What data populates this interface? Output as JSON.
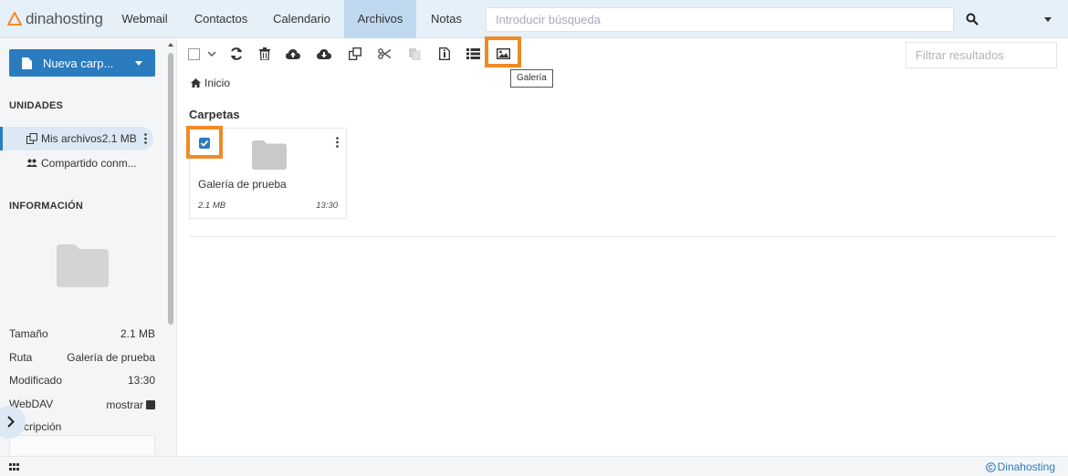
{
  "brand": {
    "name": "dinahosting",
    "accent": "#f08a24",
    "primary": "#2b7bbf"
  },
  "nav": {
    "items": [
      {
        "label": "Webmail"
      },
      {
        "label": "Contactos"
      },
      {
        "label": "Calendario"
      },
      {
        "label": "Archivos",
        "active": true
      },
      {
        "label": "Notas"
      }
    ],
    "search_placeholder": "Introducir búsqueda"
  },
  "sidebar": {
    "new_folder_label": "Nueva carp...",
    "units_heading": "UNIDADES",
    "drives": [
      {
        "label": "Mis archivos",
        "size": "2.1 MB",
        "icon": "drive-icon",
        "active": true
      },
      {
        "label": "Compartido conm...",
        "icon": "users-icon"
      }
    ],
    "info_heading": "INFORMACIÓN",
    "info": [
      {
        "label": "Tamaño",
        "value": "2.1 MB"
      },
      {
        "label": "Ruta",
        "value": "Galería de prueba"
      },
      {
        "label": "Modificado",
        "value": "13:30"
      },
      {
        "label": "WebDAV",
        "value": "mostrar"
      }
    ],
    "description_label": "scripción"
  },
  "toolbar": {
    "icons": [
      "refresh-icon",
      "trash-icon",
      "cloud-upload-icon",
      "cloud-download-icon",
      "copy-icon",
      "cut-icon",
      "paste-icon",
      "file-info-icon",
      "list-view-icon",
      "gallery-icon"
    ],
    "tooltip": "Galería",
    "filter_placeholder": "Filtrar resultados"
  },
  "breadcrumb": {
    "home": "Inicio"
  },
  "content": {
    "section_title": "Carpetas",
    "folders": [
      {
        "name": "Galería de prueba",
        "size": "2.1 MB",
        "time": "13:30",
        "checked": true
      }
    ]
  },
  "footer": {
    "copyright": "Dinahosting"
  }
}
